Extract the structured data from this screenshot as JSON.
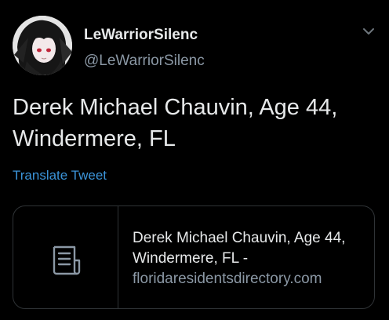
{
  "tweet": {
    "author": {
      "display_name": "LeWarriorSilenc",
      "handle": "@LeWarriorSilenc",
      "avatar_icon": "anime-girl-avatar"
    },
    "menu_icon": "chevron-down-icon",
    "text": "Derek Michael Chauvin, Age 44, Windermere, FL",
    "translate_label": "Translate Tweet",
    "card": {
      "icon": "document-icon",
      "title": "Derek Michael Chauvin, Age 44, Windermere, FL -",
      "domain": "floridaresidentsdirectory.com"
    }
  },
  "colors": {
    "background": "#000000",
    "text_primary": "#e7e9ea",
    "text_secondary": "#8b98a5",
    "link": "#3b94d9",
    "border": "#2f3336"
  }
}
